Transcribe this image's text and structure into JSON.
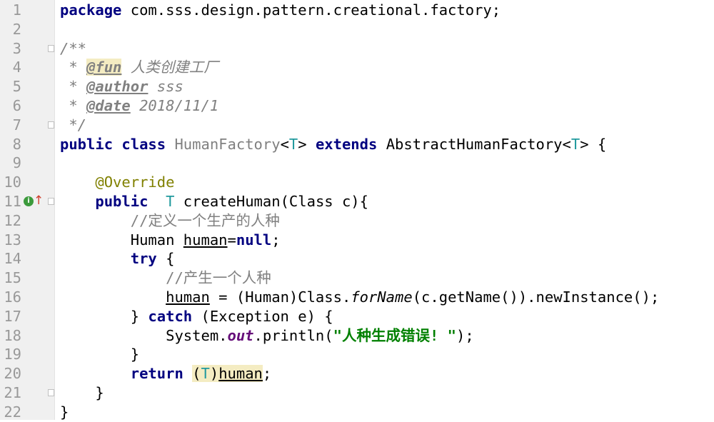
{
  "editor": {
    "lines": [
      {
        "n": "1",
        "tokens": [
          {
            "t": "package",
            "c": "kw"
          },
          {
            "t": " com.sss.design.pattern.creational.factory;",
            "c": "pkg"
          }
        ]
      },
      {
        "n": "2",
        "tokens": []
      },
      {
        "n": "3",
        "fold": true,
        "tokens": [
          {
            "t": "/**",
            "c": "doc"
          }
        ]
      },
      {
        "n": "4",
        "tokens": [
          {
            "t": " * ",
            "c": "doc"
          },
          {
            "t": "@fun",
            "c": "tag tag-hl"
          },
          {
            "t": " 人类创建工厂",
            "c": "doc"
          }
        ]
      },
      {
        "n": "5",
        "tokens": [
          {
            "t": " * ",
            "c": "doc"
          },
          {
            "t": "@author",
            "c": "tag"
          },
          {
            "t": " sss",
            "c": "doc"
          }
        ]
      },
      {
        "n": "6",
        "tokens": [
          {
            "t": " * ",
            "c": "doc"
          },
          {
            "t": "@date",
            "c": "tag"
          },
          {
            "t": " 2018/11/1",
            "c": "doc"
          }
        ]
      },
      {
        "n": "7",
        "fold": true,
        "tokens": [
          {
            "t": " */",
            "c": "doc"
          }
        ]
      },
      {
        "n": "8",
        "tokens": [
          {
            "t": "public class ",
            "c": "kw"
          },
          {
            "t": "HumanFactory",
            "c": "unused"
          },
          {
            "t": "<",
            "c": ""
          },
          {
            "t": "T",
            "c": "gen"
          },
          {
            "t": "> ",
            "c": ""
          },
          {
            "t": "extends ",
            "c": "kw"
          },
          {
            "t": "AbstractHumanFactory<",
            "c": ""
          },
          {
            "t": "T",
            "c": "gen"
          },
          {
            "t": "> {",
            "c": ""
          }
        ]
      },
      {
        "n": "9",
        "tokens": []
      },
      {
        "n": "10",
        "tokens": [
          {
            "t": "    ",
            "c": ""
          },
          {
            "t": "@Override",
            "c": "annot"
          }
        ]
      },
      {
        "n": "11",
        "fold": true,
        "icon": "i",
        "arrow": "↑",
        "tokens": [
          {
            "t": "    ",
            "c": ""
          },
          {
            "t": "public  ",
            "c": "kw"
          },
          {
            "t": "T",
            "c": "gen"
          },
          {
            "t": " createHuman(Class c){",
            "c": ""
          }
        ]
      },
      {
        "n": "12",
        "tokens": [
          {
            "t": "        ",
            "c": ""
          },
          {
            "t": "//定义一个生产的人种",
            "c": "cmt"
          }
        ]
      },
      {
        "n": "13",
        "tokens": [
          {
            "t": "        Human ",
            "c": ""
          },
          {
            "t": "human",
            "c": "ul"
          },
          {
            "t": "=",
            "c": ""
          },
          {
            "t": "null",
            "c": "kw"
          },
          {
            "t": ";",
            "c": ""
          }
        ]
      },
      {
        "n": "14",
        "tokens": [
          {
            "t": "        ",
            "c": ""
          },
          {
            "t": "try",
            "c": "kw"
          },
          {
            "t": " {",
            "c": ""
          }
        ]
      },
      {
        "n": "15",
        "tokens": [
          {
            "t": "            ",
            "c": ""
          },
          {
            "t": "//产生一个人种",
            "c": "cmt"
          }
        ]
      },
      {
        "n": "16",
        "tokens": [
          {
            "t": "            ",
            "c": ""
          },
          {
            "t": "human",
            "c": "ul"
          },
          {
            "t": " = (Human)Class.",
            "c": ""
          },
          {
            "t": "forName",
            "c": "method-static"
          },
          {
            "t": "(c.getName()).newInstance();",
            "c": ""
          }
        ]
      },
      {
        "n": "17",
        "tokens": [
          {
            "t": "        } ",
            "c": ""
          },
          {
            "t": "catch",
            "c": "kw"
          },
          {
            "t": " (Exception e) {",
            "c": ""
          }
        ]
      },
      {
        "n": "18",
        "tokens": [
          {
            "t": "            System.",
            "c": ""
          },
          {
            "t": "out",
            "c": "static"
          },
          {
            "t": ".println(",
            "c": ""
          },
          {
            "t": "\"人种生成错误! \"",
            "c": "str"
          },
          {
            "t": ");",
            "c": ""
          }
        ]
      },
      {
        "n": "19",
        "tokens": [
          {
            "t": "        }",
            "c": ""
          }
        ]
      },
      {
        "n": "20",
        "tokens": [
          {
            "t": "        ",
            "c": ""
          },
          {
            "t": "return",
            "c": "kw"
          },
          {
            "t": " ",
            "c": ""
          },
          {
            "t": "(",
            "c": "hl"
          },
          {
            "t": "T",
            "c": "gen hl"
          },
          {
            "t": ")",
            "c": "hl"
          },
          {
            "t": "human",
            "c": "ul hl"
          },
          {
            "t": ";",
            "c": ""
          }
        ]
      },
      {
        "n": "21",
        "fold": true,
        "tokens": [
          {
            "t": "    }",
            "c": ""
          }
        ]
      },
      {
        "n": "22",
        "tokens": [
          {
            "t": "}",
            "c": ""
          }
        ]
      }
    ]
  },
  "colors": {
    "keyword": "#000080",
    "doc_comment": "#808080",
    "annotation": "#808000",
    "type_param": "#20999d",
    "string": "#008000",
    "static_field": "#660e7a",
    "highlight": "#f4ecc2",
    "gutter_bg": "#f0f0f0",
    "line_number": "#999999"
  },
  "icons": {
    "implements_marker": "implements-method-icon",
    "override_marker": "override-arrow-icon",
    "fold_marker": "fold-icon"
  }
}
